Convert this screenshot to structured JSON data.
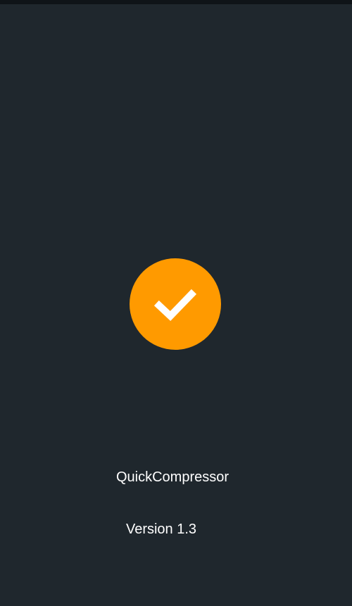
{
  "app": {
    "name": "QuickCompressor",
    "version_label": "Version 1.3"
  },
  "logo": {
    "icon": "check-icon",
    "circle_color": "#ff9a00",
    "check_color": "#ffffff"
  },
  "theme": {
    "background": "#1f272d",
    "status_bar": "#0f1418",
    "text_color": "#ffffff"
  }
}
